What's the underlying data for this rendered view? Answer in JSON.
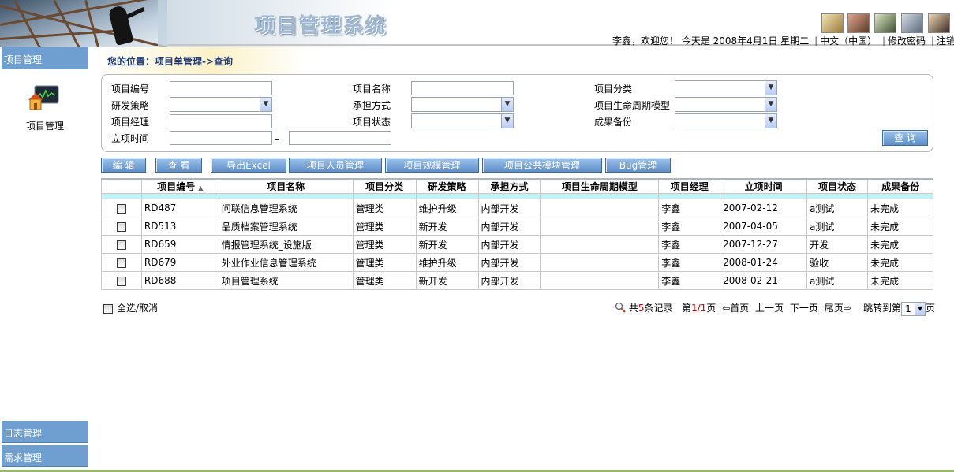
{
  "header": {
    "title": "项目管理系统",
    "user_info": "李鑫，欢迎您！ 今天是  2008年4月1日  星期二",
    "links": [
      "中文（中国）",
      "修改密码",
      "注销"
    ]
  },
  "sidebar": {
    "items": [
      {
        "label": "项目管理"
      },
      {
        "label": "日志管理"
      },
      {
        "label": "需求管理"
      }
    ],
    "project_icon_label": "项目管理"
  },
  "breadcrumb": "您的位置：项目单管理->查询",
  "search": {
    "labels": {
      "code": "项目编号",
      "name": "项目名称",
      "category": "项目分类",
      "strategy": "研发策略",
      "undertake": "承担方式",
      "lifecycle": "项目生命周期模型",
      "manager": "项目经理",
      "status": "项目状态",
      "backup": "成果备份",
      "date": "立项时间"
    },
    "date_separator": "–",
    "query_button": "查 询"
  },
  "actions": [
    "编 辑",
    "查 看",
    "导出Excel",
    "项目人员管理",
    "项目规模管理",
    "项目公共模块管理",
    "Bug管理"
  ],
  "table": {
    "columns": [
      "项目编号",
      "项目名称",
      "项目分类",
      "研发策略",
      "承担方式",
      "项目生命周期模型",
      "项目经理",
      "立项时间",
      "项目状态",
      "成果备份"
    ],
    "rows": [
      {
        "code": "RD487",
        "name": "问联信息管理系统",
        "category": "管理类",
        "strategy": "维护升级",
        "undertake": "内部开发",
        "lifecycle": "",
        "manager": "李鑫",
        "date": "2007-02-12",
        "status": "a测试",
        "backup": "未完成"
      },
      {
        "code": "RD513",
        "name": "品质档案管理系统",
        "category": "管理类",
        "strategy": "新开发",
        "undertake": "内部开发",
        "lifecycle": "",
        "manager": "李鑫",
        "date": "2007-04-05",
        "status": "a测试",
        "backup": "未完成"
      },
      {
        "code": "RD659",
        "name": "情报管理系统_设施版",
        "category": "管理类",
        "strategy": "新开发",
        "undertake": "内部开发",
        "lifecycle": "",
        "manager": "李鑫",
        "date": "2007-12-27",
        "status": "开发",
        "backup": "未完成"
      },
      {
        "code": "RD679",
        "name": "外业作业信息管理系统",
        "category": "管理类",
        "strategy": "维护升级",
        "undertake": "内部开发",
        "lifecycle": "",
        "manager": "李鑫",
        "date": "2008-01-24",
        "status": "验收",
        "backup": "未完成"
      },
      {
        "code": "RD688",
        "name": "项目管理系统",
        "category": "管理类",
        "strategy": "新开发",
        "undertake": "内部开发",
        "lifecycle": "",
        "manager": "李鑫",
        "date": "2008-02-21",
        "status": "a测试",
        "backup": "未完成"
      }
    ]
  },
  "footer": {
    "select_all": "全选/取消",
    "pager": {
      "total_prefix": "共",
      "total_count": "5",
      "total_suffix": "条记录",
      "page_prefix": "第",
      "page_current": "1/1",
      "page_suffix": "页",
      "first": "首页",
      "prev": "上一页",
      "next": "下一页",
      "last": "尾页",
      "jump_prefix": "跳转到第",
      "jump_value": "1",
      "jump_suffix": "页"
    }
  },
  "colors": {
    "sidebar_tab": "#6f9fd1",
    "button": "#5e8fc9",
    "table_subheader": "#bff3f5",
    "breadcrumb_text": "#1f3b73",
    "record_count": "#d40000"
  }
}
